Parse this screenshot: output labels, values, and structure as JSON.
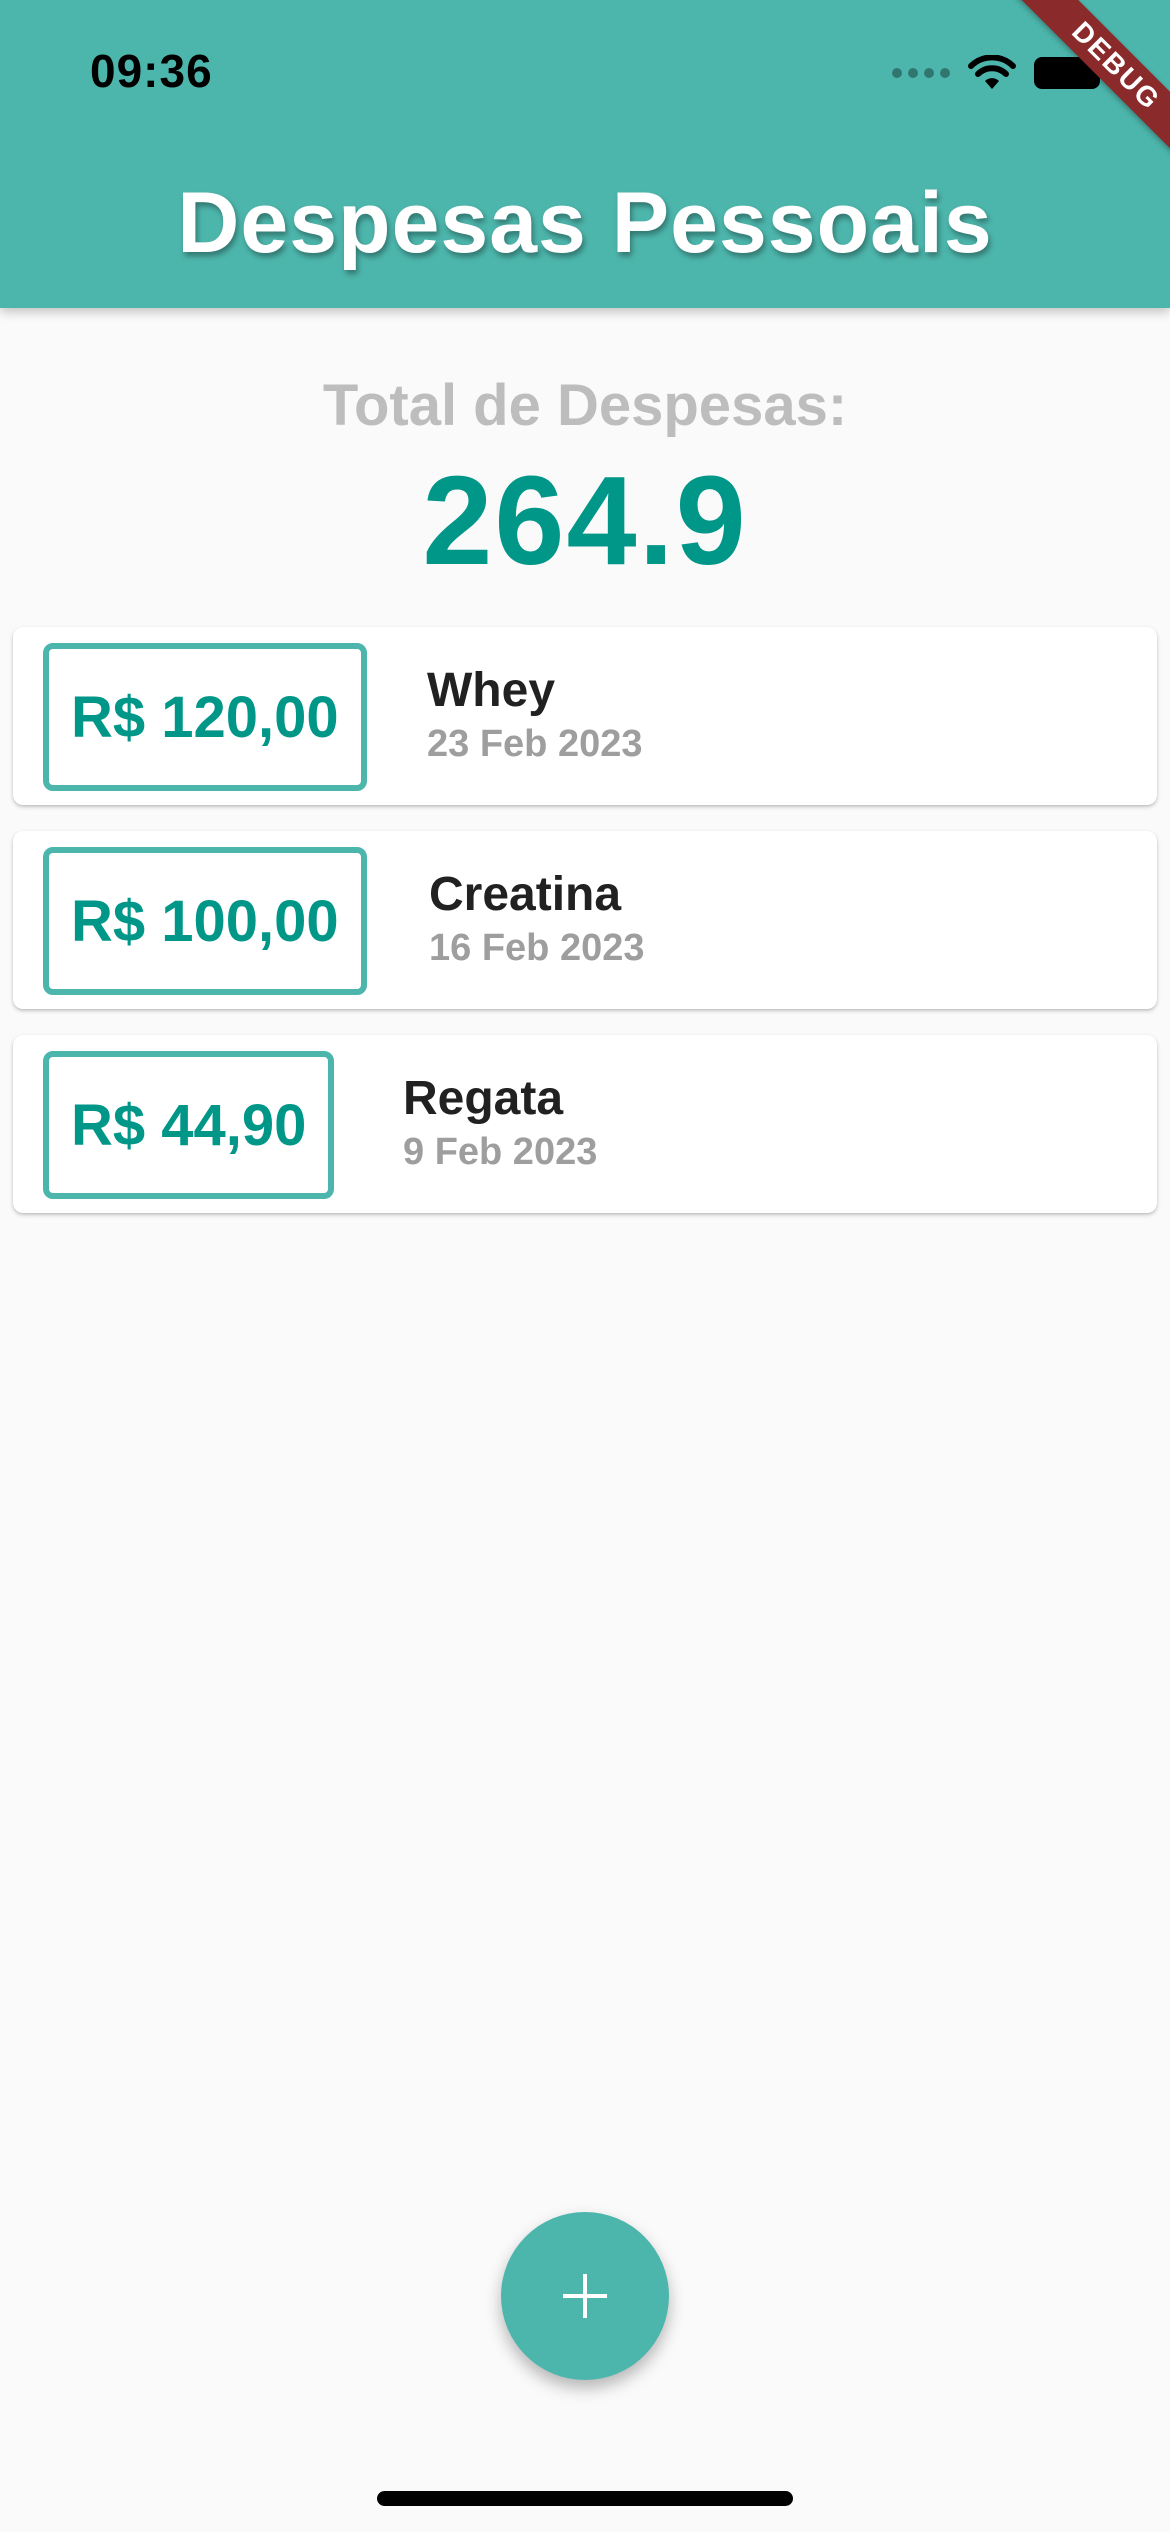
{
  "status_bar": {
    "time": "09:36"
  },
  "debug_banner": "DEBUG",
  "app_bar": {
    "title": "Despesas Pessoais"
  },
  "summary": {
    "label": "Total de Despesas:",
    "total": "264.9"
  },
  "transactions": [
    {
      "price": "R$ 120,00",
      "title": "Whey",
      "date": "23 Feb 2023"
    },
    {
      "price": "R$ 100,00",
      "title": "Creatina",
      "date": "16 Feb 2023"
    },
    {
      "price": "R$ 44,90",
      "title": "Regata",
      "date": "9 Feb 2023"
    }
  ],
  "fab": {
    "icon": "plus-icon"
  },
  "colors": {
    "primary": "#4db6ac",
    "accent_text": "#009688",
    "debug_banner": "#8b2a2a"
  }
}
